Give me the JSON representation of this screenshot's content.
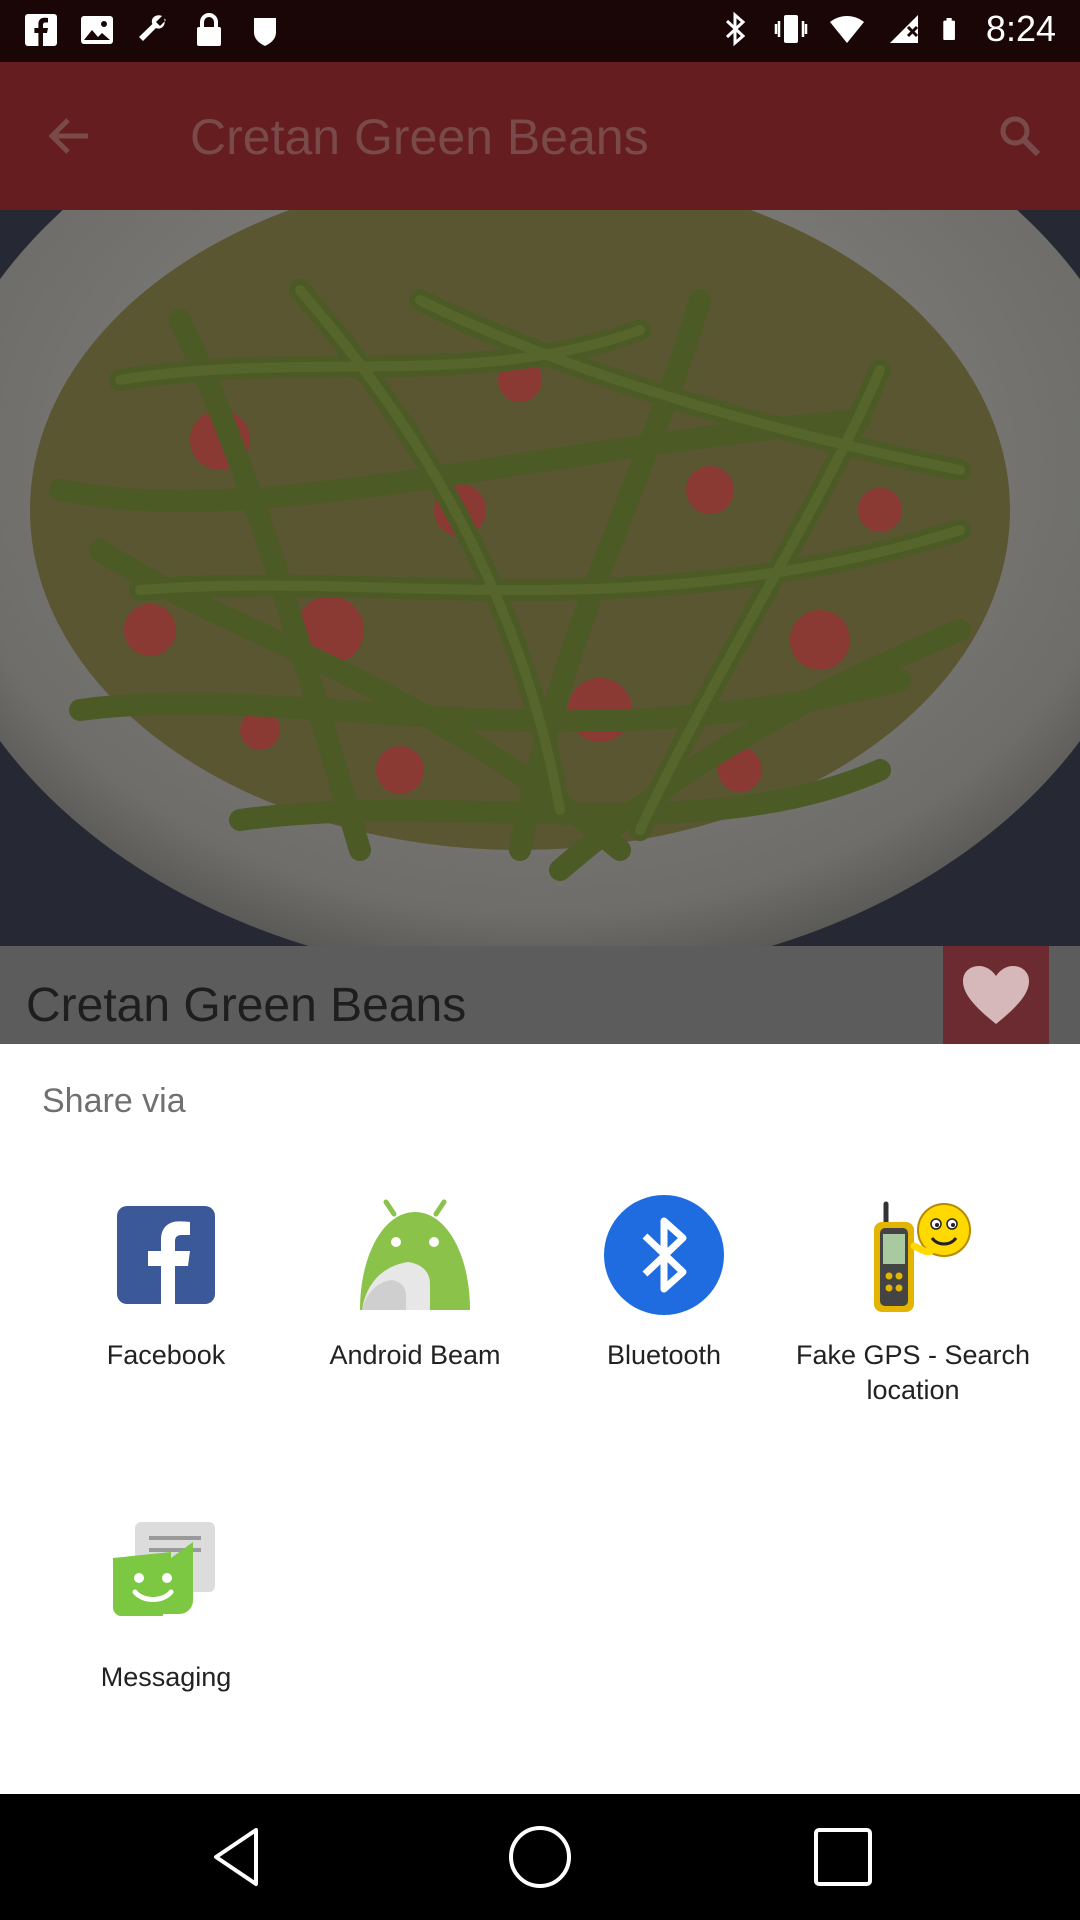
{
  "status_bar": {
    "time": "8:24",
    "left_icons": [
      "facebook-icon",
      "image-icon",
      "wrench-icon",
      "lock-icon",
      "shield-icon"
    ],
    "right_icons": [
      "bluetooth-icon",
      "vibrate-icon",
      "wifi-icon",
      "no-sim-icon",
      "battery-icon"
    ]
  },
  "app_bar": {
    "title": "Cretan Green Beans",
    "back_icon": "back-arrow-icon",
    "search_icon": "search-icon",
    "color": "#651d1f"
  },
  "recipe": {
    "name": "Cretan Green Beans",
    "favorite_icon": "heart-icon"
  },
  "share_sheet": {
    "title": "Share via",
    "apps": [
      {
        "label": "Facebook",
        "icon": "facebook-icon"
      },
      {
        "label": "Android Beam",
        "icon": "android-beam-icon"
      },
      {
        "label": "Bluetooth",
        "icon": "bluetooth-icon"
      },
      {
        "label": "Fake GPS - Search location",
        "icon": "gps-device-icon"
      },
      {
        "label": "Messaging",
        "icon": "messaging-icon"
      }
    ]
  },
  "nav_bar": {
    "buttons": [
      "back-triangle-icon",
      "home-circle-icon",
      "recents-square-icon"
    ]
  },
  "colors": {
    "facebook": "#3b5998",
    "android": "#8bc34a",
    "bluetooth": "#1e6ce0",
    "messaging": "#7cc843"
  }
}
